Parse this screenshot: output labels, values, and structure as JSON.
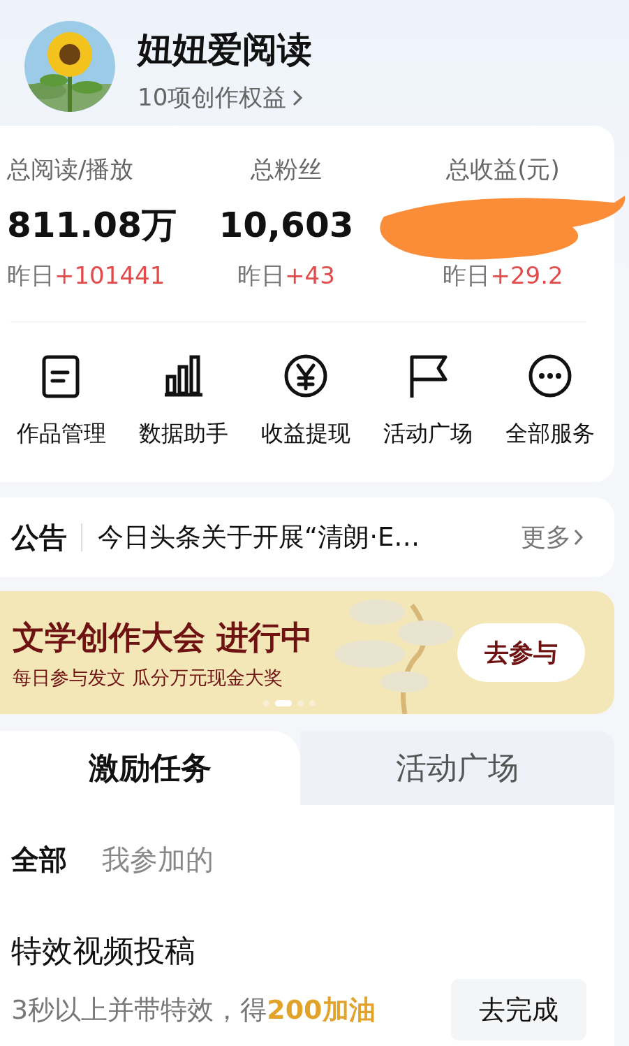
{
  "profile": {
    "name": "妞妞爱阅读",
    "benefits_link": "10项创作权益"
  },
  "stats": [
    {
      "label": "总阅读/播放",
      "value": "811.08万",
      "delta_label": "昨日",
      "delta": "+101441",
      "redacted": false
    },
    {
      "label": "总粉丝",
      "value": "10,603",
      "delta_label": "昨日",
      "delta": "+43",
      "redacted": false
    },
    {
      "label": "总收益(元)",
      "delta_label": "昨日",
      "delta": "+29.2",
      "redacted": true
    }
  ],
  "services": [
    {
      "label": "作品管理"
    },
    {
      "label": "数据助手"
    },
    {
      "label": "收益提现"
    },
    {
      "label": "活动广场"
    },
    {
      "label": "全部服务"
    }
  ],
  "notice": {
    "tag": "公告",
    "text": "今日头条关于开展“清朗·E…",
    "more": "更多"
  },
  "banner": {
    "title": "文学创作大会 进行中",
    "subtitle": "每日参与发文 瓜分万元现金大奖",
    "button": "去参与",
    "dots": [
      {
        "selected": false
      },
      {
        "selected": true
      },
      {
        "selected": false
      },
      {
        "selected": false
      }
    ]
  },
  "tabs": [
    {
      "label": "激励任务",
      "selected": true
    },
    {
      "label": "活动广场",
      "selected": false
    }
  ],
  "filters": [
    {
      "label": "全部",
      "selected": true
    },
    {
      "label": "我参加的",
      "selected": false
    }
  ],
  "tasks": [
    {
      "title": "特效视频投稿",
      "description": "3秒以上并带特效，得**200加油**",
      "button": "去完成"
    }
  ]
}
